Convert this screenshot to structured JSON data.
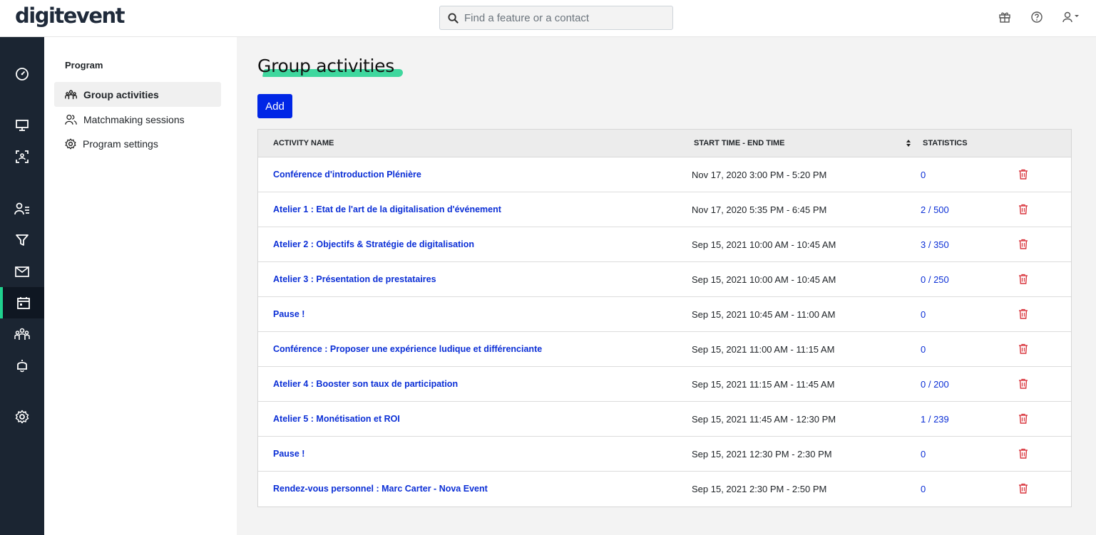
{
  "brand": {
    "logo_text_a": "digit",
    "logo_text_b": "event",
    "accent": "#1fd18e",
    "primary": "#0026e6"
  },
  "search": {
    "placeholder": "Find a feature or a contact"
  },
  "topbar_icons": [
    "gift-icon",
    "help-icon",
    "user-menu-icon"
  ],
  "rail_items": [
    "dashboard-icon",
    "display-icon",
    "qr-scan-icon",
    "contacts-icon",
    "filter-icon",
    "email-icon",
    "calendar-icon",
    "groups-icon",
    "bell-icon",
    "settings-icon"
  ],
  "subnav": {
    "title": "Program",
    "items": [
      {
        "label": "Group activities",
        "icon": "groups-icon",
        "active": true
      },
      {
        "label": "Matchmaking sessions",
        "icon": "people-icon",
        "active": false
      },
      {
        "label": "Program settings",
        "icon": "gear-icon",
        "active": false
      }
    ]
  },
  "main": {
    "title": "Group activities",
    "add_label": "Add"
  },
  "table": {
    "headers": {
      "name": "ACTIVITY NAME",
      "time": "START TIME - END TIME",
      "stats": "STATISTICS"
    },
    "rows": [
      {
        "name": "Conférence d'introduction Plénière",
        "time": "Nov 17, 2020 3:00 PM - 5:20 PM",
        "stat": "0"
      },
      {
        "name": "Atelier 1 : Etat de l'art de la digitalisation d'événement",
        "time": "Nov 17, 2020 5:35 PM - 6:45 PM",
        "stat": "2 / 500"
      },
      {
        "name": "Atelier 2 : Objectifs & Stratégie de digitalisation",
        "time": "Sep 15, 2021 10:00 AM - 10:45 AM",
        "stat": "3 / 350"
      },
      {
        "name": "Atelier 3 : Présentation de prestataires",
        "time": "Sep 15, 2021 10:00 AM - 10:45 AM",
        "stat": "0 / 250"
      },
      {
        "name": "Pause !",
        "time": "Sep 15, 2021 10:45 AM - 11:00 AM",
        "stat": "0"
      },
      {
        "name": "Conférence : Proposer une expérience ludique et différenciante",
        "time": "Sep 15, 2021 11:00 AM - 11:15 AM",
        "stat": "0"
      },
      {
        "name": "Atelier 4 : Booster son taux de participation",
        "time": "Sep 15, 2021 11:15 AM - 11:45 AM",
        "stat": "0 / 200"
      },
      {
        "name": "Atelier 5 : Monétisation et ROI",
        "time": "Sep 15, 2021 11:45 AM - 12:30 PM",
        "stat": "1 / 239"
      },
      {
        "name": "Pause !",
        "time": "Sep 15, 2021 12:30 PM - 2:30 PM",
        "stat": "0"
      },
      {
        "name": "Rendez-vous personnel : Marc Carter - Nova Event",
        "time": "Sep 15, 2021 2:30 PM - 2:50 PM",
        "stat": "0"
      }
    ]
  }
}
